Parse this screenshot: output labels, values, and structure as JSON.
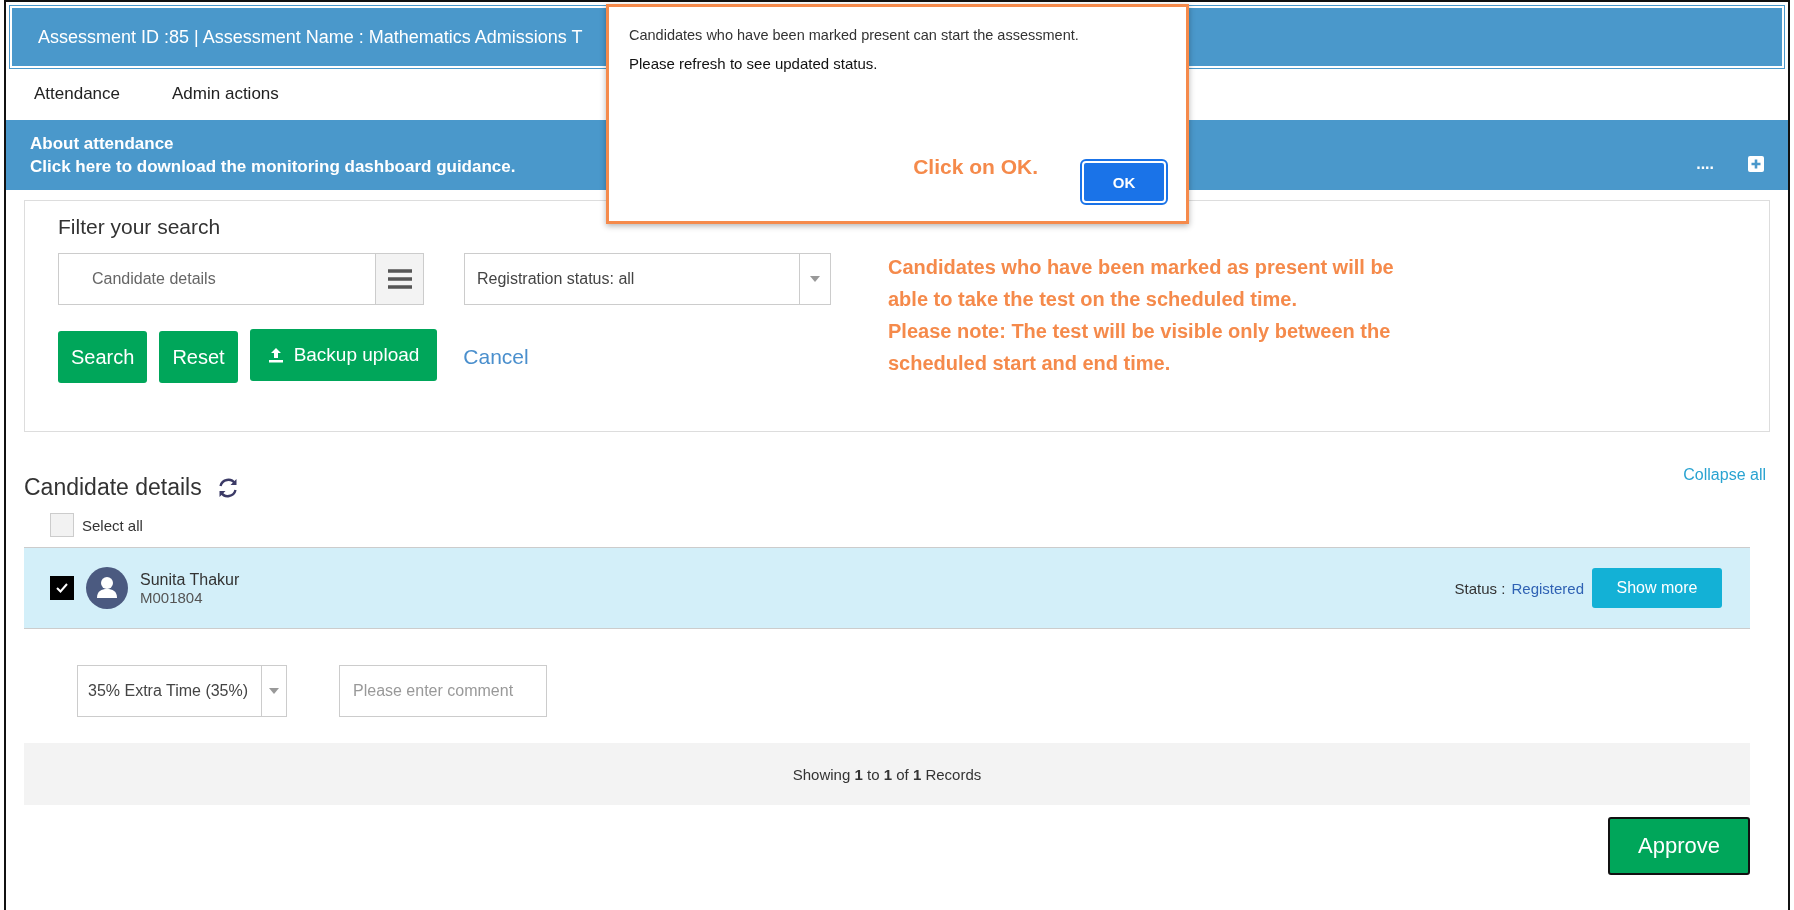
{
  "header": {
    "title": "Assessment ID :85 | Assessment Name : Mathematics Admissions T"
  },
  "tabs": [
    {
      "label": "Attendance"
    },
    {
      "label": "Admin actions"
    }
  ],
  "about": {
    "title": "About attendance",
    "link": "Click here to download the monitoring dashboard guidance.",
    "more": "...."
  },
  "filter": {
    "heading": "Filter your search",
    "candidate_field": {
      "placeholder": "Candidate details"
    },
    "status_select": {
      "value": "Registration status: all"
    },
    "buttons": [
      {
        "label": "Search",
        "kind": "button"
      },
      {
        "label": "Reset",
        "kind": "button"
      },
      {
        "label": "Backup upload",
        "kind": "upload"
      },
      {
        "label": "Cancel",
        "kind": "link"
      }
    ]
  },
  "note": [
    "Candidates who have been marked as present will be able to take the test on the scheduled time.",
    "Please note: The test will be visible only between the scheduled start and end time."
  ],
  "candidates": {
    "heading": "Candidate details",
    "collapse": "Collapse all",
    "select_all": {
      "label": "Select all",
      "checked": false
    },
    "rows": [
      {
        "name": "Sunita Thakur",
        "id": "M001804",
        "checked": true,
        "selected": true,
        "status_label": "Status :",
        "status": "Registered",
        "button": "Show more",
        "time_select": "35% Extra Time (35%)",
        "comment": {
          "placeholder": "Please enter comment"
        }
      }
    ],
    "pager": "Showing **1** to **1** of **1** Records"
  },
  "approve": "Approve",
  "dialog": {
    "message": "Candidates who have been  marked present can start the assessment.",
    "note": "Please refresh to see updated status.",
    "hint": "Click on OK.",
    "ok": "OK"
  }
}
